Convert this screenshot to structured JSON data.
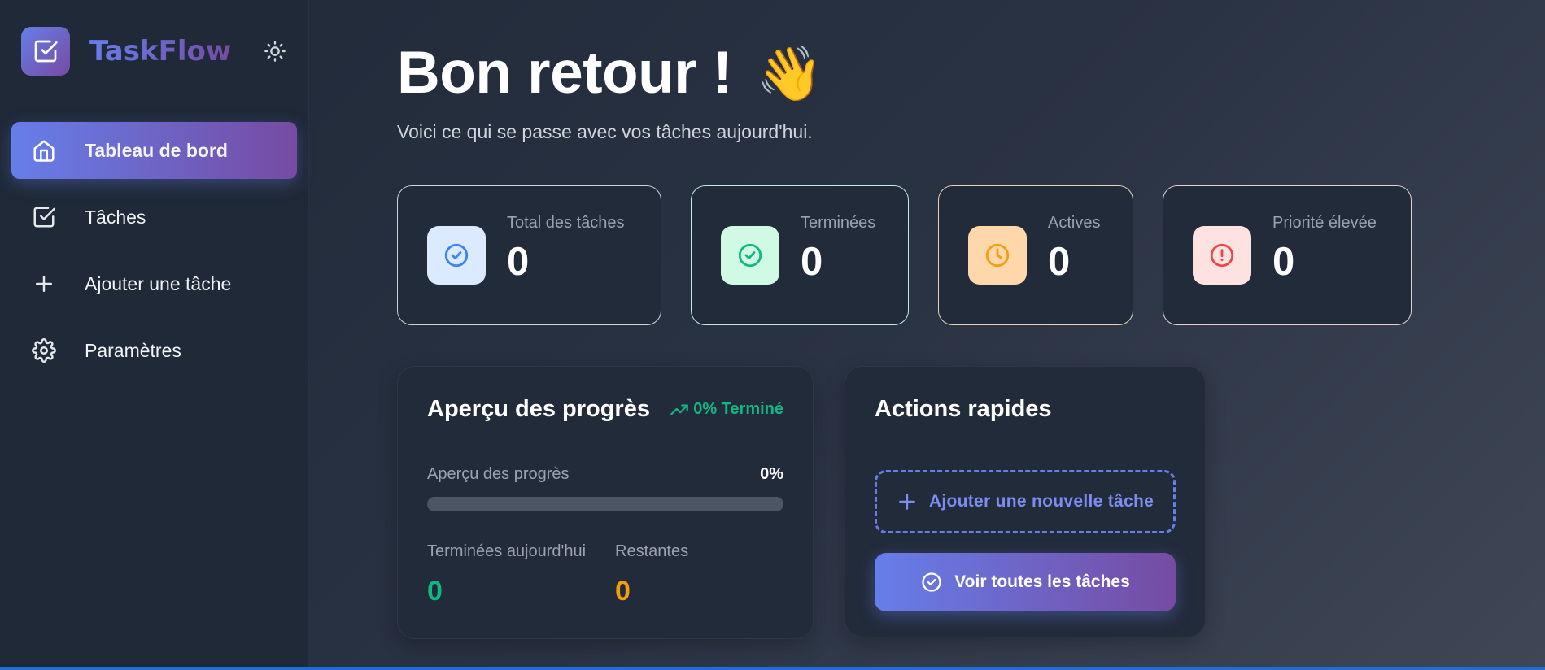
{
  "app": {
    "name": "TaskFlow"
  },
  "sidebar": {
    "theme_toggle_icon": "sun-icon",
    "items": [
      {
        "label": "Tableau de bord",
        "icon": "home-icon",
        "active": true
      },
      {
        "label": "Tâches",
        "icon": "checkbox-icon",
        "active": false
      },
      {
        "label": "Ajouter une tâche",
        "icon": "plus-icon",
        "active": false
      },
      {
        "label": "Paramètres",
        "icon": "gear-icon",
        "active": false
      }
    ]
  },
  "header": {
    "title": "Bon retour !",
    "emoji": "👋",
    "subtitle": "Voici ce qui se passe avec vos tâches aujourd'hui."
  },
  "stats": [
    {
      "label": "Total des tâches",
      "value": "0",
      "icon": "check-circle-icon",
      "color": "#3b82f6",
      "bg": "#dbeafe",
      "border": "#d1d5db"
    },
    {
      "label": "Terminées",
      "value": "0",
      "icon": "check-circle-icon",
      "color": "#10b981",
      "bg": "#d1fae5",
      "border": "#c7eadf"
    },
    {
      "label": "Actives",
      "value": "0",
      "icon": "clock-icon",
      "color": "#f59e0b",
      "bg": "#fed7aa",
      "border": "#e8d4b4"
    },
    {
      "label": "Priorité élevée",
      "value": "0",
      "icon": "alert-circle-icon",
      "color": "#ef4444",
      "bg": "#fee2e2",
      "border": "#e5cfcf"
    }
  ],
  "progress": {
    "title": "Aperçu des progrès",
    "badge": "0% Terminé",
    "bar_label": "Aperçu des progrès",
    "percent_text": "0%",
    "percent": 0,
    "completed_today_label": "Terminées aujourd'hui",
    "completed_today_value": "0",
    "remaining_label": "Restantes",
    "remaining_value": "0",
    "accent_green": "#10b981",
    "accent_orange": "#f59e0b"
  },
  "actions": {
    "title": "Actions rapides",
    "add_label": "Ajouter une nouvelle tâche",
    "view_all_label": "Voir toutes les tâches"
  }
}
